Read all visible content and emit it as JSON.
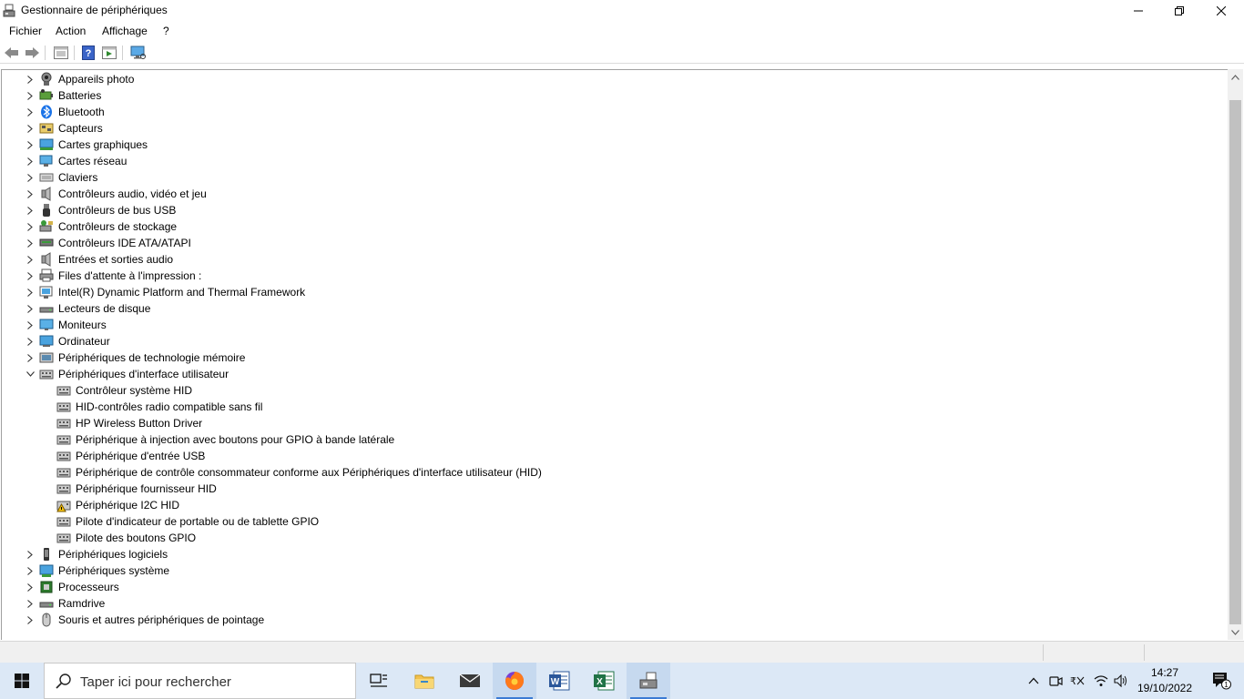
{
  "window": {
    "title": "Gestionnaire de périphériques"
  },
  "menu": [
    "Fichier",
    "Action",
    "Affichage",
    "?"
  ],
  "toolbar": {
    "icons": [
      "back-arrow-icon",
      "forward-arrow-icon",
      "properties-icon",
      "help-icon",
      "update-driver-icon",
      "monitor-scan-icon"
    ]
  },
  "tree": {
    "top_items_before": [
      {
        "label": "Appareils photo",
        "icon": "camera-icon"
      },
      {
        "label": "Batteries",
        "icon": "battery-icon"
      },
      {
        "label": "Bluetooth",
        "icon": "bluetooth-icon"
      },
      {
        "label": "Capteurs",
        "icon": "sensor-icon"
      },
      {
        "label": "Cartes graphiques",
        "icon": "display-adapter-icon"
      },
      {
        "label": "Cartes réseau",
        "icon": "network-adapter-icon"
      },
      {
        "label": "Claviers",
        "icon": "keyboard-icon"
      },
      {
        "label": "Contrôleurs audio, vidéo et jeu",
        "icon": "speaker-icon"
      },
      {
        "label": "Contrôleurs de bus USB",
        "icon": "usb-icon"
      },
      {
        "label": "Contrôleurs de stockage",
        "icon": "storage-icon"
      },
      {
        "label": "Contrôleurs IDE ATA/ATAPI",
        "icon": "ide-icon"
      },
      {
        "label": "Entrées et sorties audio",
        "icon": "speaker-icon"
      },
      {
        "label": "Files d'attente à l'impression :",
        "icon": "printer-icon"
      },
      {
        "label": "Intel(R) Dynamic Platform and Thermal Framework",
        "icon": "chip-icon"
      },
      {
        "label": "Lecteurs de disque",
        "icon": "disk-drive-icon"
      },
      {
        "label": "Moniteurs",
        "icon": "monitor-icon"
      },
      {
        "label": "Ordinateur",
        "icon": "computer-icon"
      },
      {
        "label": "Périphériques de technologie mémoire",
        "icon": "memory-icon"
      }
    ],
    "expanded_item": {
      "label": "Périphériques d'interface utilisateur",
      "icon": "hid-icon"
    },
    "children": [
      {
        "label": "Contrôleur système HID",
        "icon": "hid-icon",
        "warning": false
      },
      {
        "label": "HID-contrôles radio compatible sans fil",
        "icon": "hid-icon",
        "warning": false
      },
      {
        "label": "HP Wireless Button Driver",
        "icon": "hid-icon",
        "warning": false
      },
      {
        "label": "Périphérique à injection avec boutons pour GPIO à bande latérale",
        "icon": "hid-icon",
        "warning": false
      },
      {
        "label": "Périphérique d'entrée USB",
        "icon": "hid-icon",
        "warning": false
      },
      {
        "label": "Périphérique de contrôle consommateur conforme aux Périphériques d'interface utilisateur (HID)",
        "icon": "hid-icon",
        "warning": false
      },
      {
        "label": "Périphérique fournisseur HID",
        "icon": "hid-icon",
        "warning": false
      },
      {
        "label": "Périphérique I2C HID",
        "icon": "hid-warning-icon",
        "warning": true
      },
      {
        "label": "Pilote d'indicateur de portable ou de tablette GPIO",
        "icon": "hid-icon",
        "warning": false
      },
      {
        "label": "Pilote des boutons GPIO",
        "icon": "hid-icon",
        "warning": false
      }
    ],
    "top_items_after": [
      {
        "label": "Périphériques logiciels",
        "icon": "software-device-icon"
      },
      {
        "label": "Périphériques système",
        "icon": "system-device-icon"
      },
      {
        "label": "Processeurs",
        "icon": "processor-icon"
      },
      {
        "label": "Ramdrive",
        "icon": "disk-drive-icon"
      },
      {
        "label": "Souris et autres périphériques de pointage",
        "icon": "mouse-icon"
      }
    ]
  },
  "taskbar": {
    "search_placeholder": "Taper ici pour rechercher",
    "apps": [
      "task-view-icon",
      "file-explorer-icon",
      "mail-icon",
      "firefox-icon",
      "word-icon",
      "excel-icon",
      "device-manager-icon"
    ],
    "time": "14:27",
    "date": "19/10/2022",
    "notification_count": "1"
  }
}
